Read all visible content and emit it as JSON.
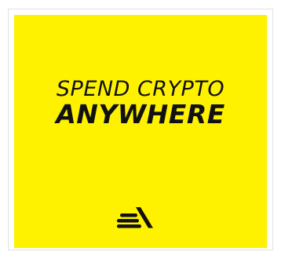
{
  "headline": {
    "line1": "SPEND CRYPTO",
    "line2": "ANYWHERE"
  },
  "logo": {
    "icon": "brand-logo-icon"
  },
  "colors": {
    "background": "#fff200",
    "text": "#111111"
  }
}
